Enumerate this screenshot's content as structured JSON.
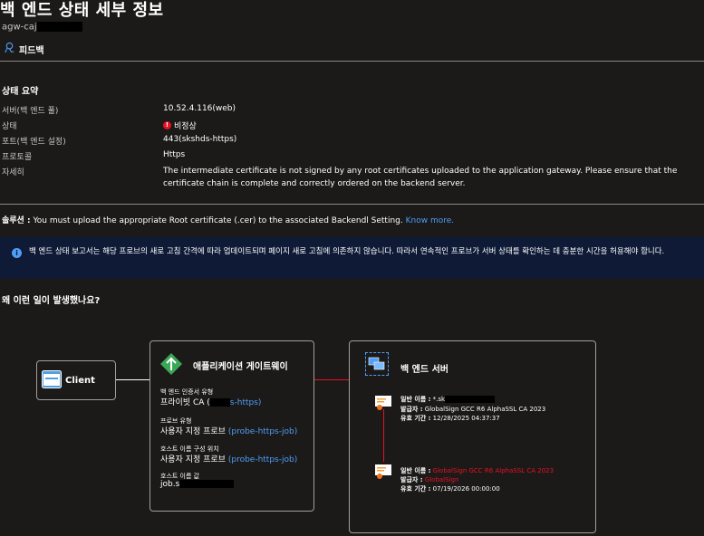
{
  "header": {
    "title": "백 엔드 상태 세부 정보",
    "subtitle_prefix": "agw-caj",
    "feedback_label": "피드백"
  },
  "summary": {
    "heading": "상태 요약",
    "rows": [
      {
        "label": "서버(백 엔드 풀)",
        "value": "10.52.4.116(web)"
      },
      {
        "label": "상태",
        "value": "비정상"
      },
      {
        "label": "포트(백 엔드 설정)",
        "value": "443(skshds-https)"
      },
      {
        "label": "프로토콜",
        "value": "Https"
      },
      {
        "label": "자세히",
        "value": "The intermediate certificate is not signed by any root certificates uploaded to the application gateway. Please ensure that the certificate chain is complete and correctly ordered on the backend server."
      }
    ]
  },
  "solution": {
    "label": "솔루션 :",
    "text": " You must upload the appropriate Root certificate (.cer) to the associated Backendl Setting.",
    "link": "Know more."
  },
  "info_banner": {
    "text": "백 엔드 상태 보고서는 해당 프로브의 새로 고침 간격에 따라 업데이트되며 페이지 새로 고침에 의존하지 않습니다. 따라서 연속적인 프로브가 서버 상태를 확인하는 데 충분한 시간을 허용해야 합니다."
  },
  "why": {
    "heading": "왜 이런 일이 발생했나요?"
  },
  "diagram": {
    "client_label": "Client",
    "gateway": {
      "title": "애플리케이션 게이트웨이",
      "items": [
        {
          "label": "백 엔드 인증서 유형",
          "value": "프라이빗 CA (",
          "link": "s-https)"
        },
        {
          "label": "프로브 유형",
          "value": "사용자 지정 프로브",
          "link": "(probe-https-job)"
        },
        {
          "label": "호스트 이름 구성 위치",
          "value": "사용자 지정 프로브",
          "link": "(probe-https-job)"
        },
        {
          "label": "호스트 이름 값",
          "value": "job.s",
          "link": ""
        }
      ]
    },
    "backend": {
      "title": "백 엔드 서버",
      "cert1": {
        "name_label": "일반 이름 :",
        "name_value": "*.sk",
        "issuer_label": "발급자 :",
        "issuer_value": "GlobalSign GCC R6 AlphaSSL CA 2023",
        "validity_label": "유효 기간 :",
        "validity_value": "12/28/2025 04:37:37"
      },
      "cert2": {
        "name_label": "일반 이름 :",
        "name_value": "GlobalSign GCC R6 AlphaSSL CA 2023",
        "issuer_label": "발급자 :",
        "issuer_value": "GlobalSign",
        "validity_label": "유효 기간 :",
        "validity_value": "07/19/2026 00:00:00"
      }
    }
  },
  "colors": {
    "background": "#1b1a19",
    "link": "#4f9ef8",
    "error": "#e81123",
    "banner": "#0e1a36"
  }
}
